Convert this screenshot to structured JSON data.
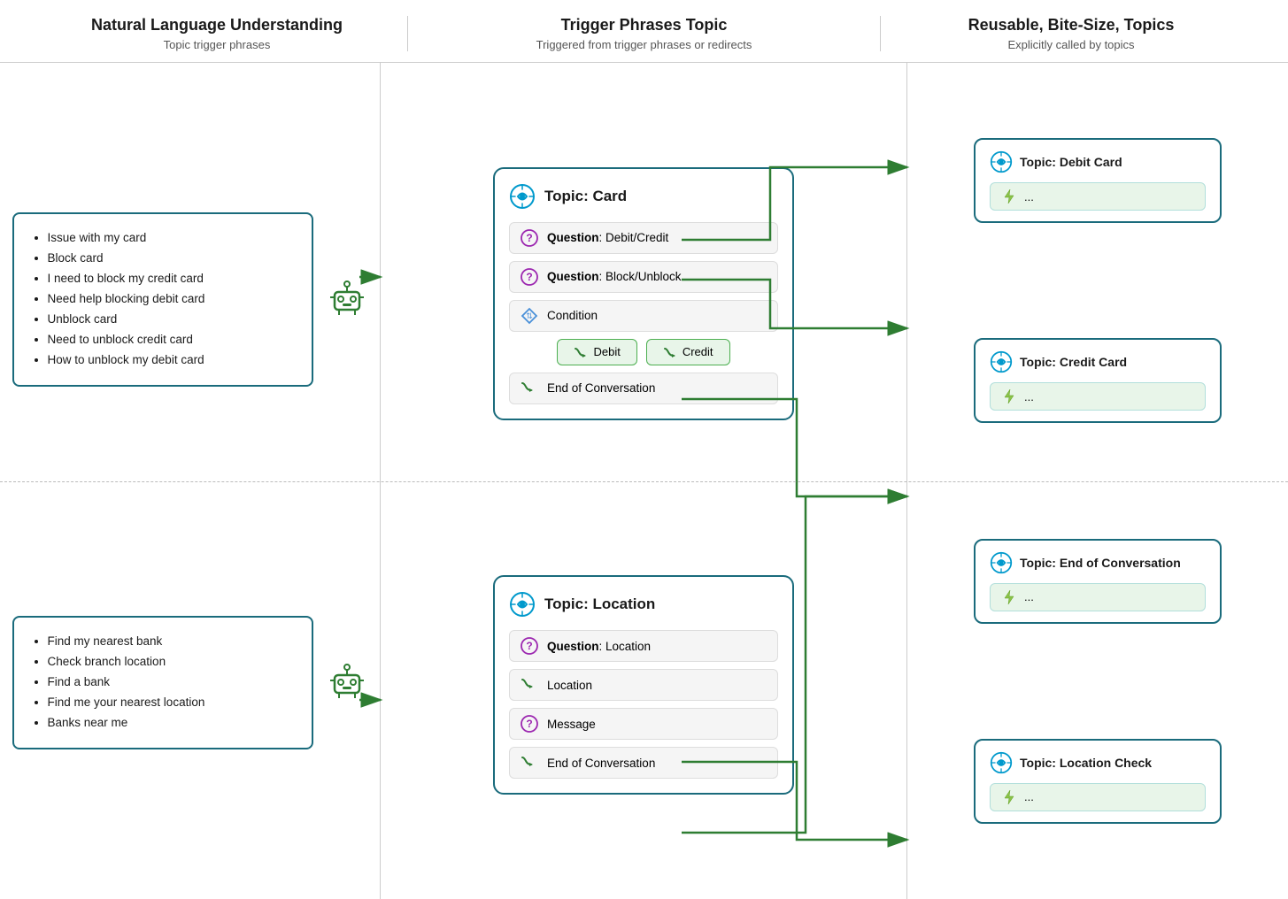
{
  "header": {
    "col1": {
      "title": "Natural Language Understanding",
      "sub": "Topic trigger phrases"
    },
    "col2": {
      "title": "Trigger Phrases Topic",
      "sub": "Triggered from trigger phrases or redirects"
    },
    "col3": {
      "title": "Reusable, Bite-Size, Topics",
      "sub": "Explicitly called by topics"
    }
  },
  "row1": {
    "nlu_phrases": [
      "Issue with my card",
      "Block card",
      "I need to block my credit card",
      "Need help blocking debit card",
      "Unblock card",
      "Need to unblock credit card",
      "How to unblock my debit card"
    ],
    "topic_title": "Topic: Card",
    "nodes": [
      {
        "type": "question",
        "text": "Question",
        "detail": "Debit/Credit"
      },
      {
        "type": "question",
        "text": "Question",
        "detail": "Block/Unblock"
      },
      {
        "type": "condition",
        "text": "Condition"
      },
      {
        "type": "end",
        "text": "End of Conversation"
      }
    ],
    "branches": [
      "Debit",
      "Credit"
    ]
  },
  "row2": {
    "nlu_phrases": [
      "Find my nearest bank",
      "Check branch location",
      "Find a bank",
      "Find me your nearest location",
      "Banks near me"
    ],
    "topic_title": "Topic: Location",
    "nodes": [
      {
        "type": "question",
        "text": "Question",
        "detail": "Location"
      },
      {
        "type": "goto",
        "text": "Location"
      },
      {
        "type": "question2",
        "text": "Message"
      },
      {
        "type": "end",
        "text": "End of Conversation"
      }
    ]
  },
  "reuse_cards": [
    {
      "title": "Topic: Debit Card",
      "content": "..."
    },
    {
      "title": "Topic: Credit Card",
      "content": "..."
    },
    {
      "title": "Topic: End of Conversation",
      "content": "..."
    },
    {
      "title": "Topic: Location Check",
      "content": "..."
    }
  ]
}
